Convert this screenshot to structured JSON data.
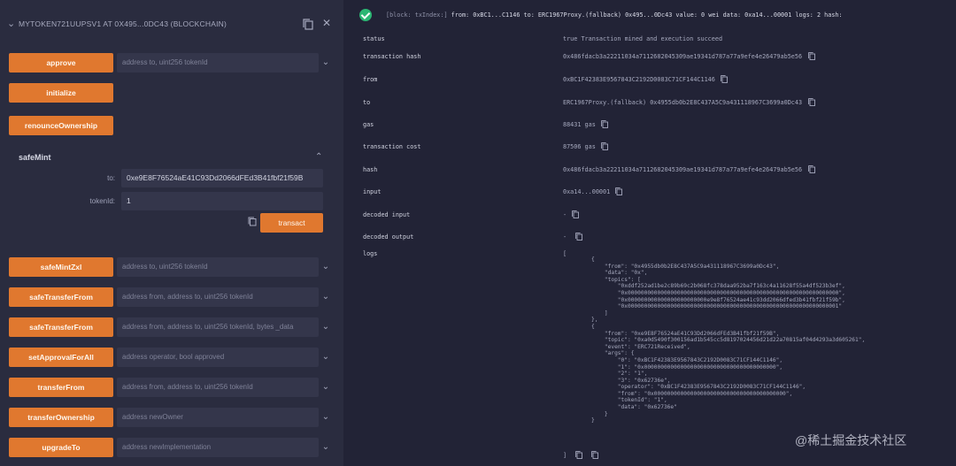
{
  "left": {
    "title": "MYTOKEN721UUPSV1 AT 0X495...0DC43 (BLOCKCHAIN)",
    "functions_top": [
      {
        "label": "approve",
        "placeholder": "address to, uint256 tokenId",
        "has_chevron": true
      },
      {
        "label": "initialize",
        "placeholder": "",
        "has_chevron": false
      },
      {
        "label": "renounceOwnership",
        "placeholder": "",
        "has_chevron": false
      }
    ],
    "safe_mint": {
      "title": "safeMint",
      "to_label": "to:",
      "to_value": "0xe9E8F76524aE41C93Dd2066dFEd3B41fbf21f59B",
      "token_label": "tokenId:",
      "token_value": "1",
      "transact_label": "transact"
    },
    "functions_bottom": [
      {
        "label": "safeMintZxl",
        "placeholder": "address to, uint256 tokenId"
      },
      {
        "label": "safeTransferFrom",
        "placeholder": "address from, address to, uint256 tokenId"
      },
      {
        "label": "safeTransferFrom",
        "placeholder": "address from, address to, uint256 tokenId, bytes _data"
      },
      {
        "label": "setApprovalForAll",
        "placeholder": "address operator, bool approved"
      },
      {
        "label": "transferFrom",
        "placeholder": "address from, address to, uint256 tokenId"
      },
      {
        "label": "transferOwnership",
        "placeholder": "address newOwner"
      },
      {
        "label": "upgradeTo",
        "placeholder": "address newImplementation"
      }
    ]
  },
  "right": {
    "summary_prefix": "[block: txIndex:]",
    "summary_rest": "from: 0xBC1...C1146 to: ERC1967Proxy.(fallback) 0x495...0Dc43 value: 0 wei data: 0xa14...00001 logs: 2 hash:",
    "rows": [
      {
        "key": "status",
        "value": "true Transaction mined and execution succeed",
        "copy": false
      },
      {
        "key": "transaction hash",
        "value": "0x486fdacb3a22211034a7112682045309ae19341d787a77a9efe4e26479ab5e56",
        "copy": true
      },
      {
        "key": "from",
        "value": "0xBC1F42383E9567843C2192D0083C71CF144C1146",
        "copy": true
      },
      {
        "key": "to",
        "value": "ERC1967Proxy.(fallback) 0x4955db0b2E8C437A5C9a431118967C3699a0Dc43",
        "copy": true
      },
      {
        "key": "gas",
        "value": "88431 gas",
        "copy": true
      },
      {
        "key": "transaction cost",
        "value": "87506 gas",
        "copy": true
      },
      {
        "key": "hash",
        "value": "0x486fdacb3a22211034a7112682045309ae19341d787a77a9efe4e26479ab5e56",
        "copy": true
      },
      {
        "key": "input",
        "value": "0xa14...00001",
        "copy": true
      },
      {
        "key": "decoded input",
        "value": "-",
        "copy": true
      },
      {
        "key": "decoded output",
        "value": " -",
        "copy": true
      },
      {
        "key": "logs",
        "value": "[",
        "copy": false
      }
    ],
    "logs_lines": [
      "{",
      "    \"from\": \"0x4955db0b2E8C437A5C9a431118967C3699a0Dc43\",",
      "    \"data\": \"0x\",",
      "    \"topics\": [",
      "        \"0xddf252ad1be2c89b69c2b068fc378daa952ba7f163c4a11628f55a4df523b3ef\",",
      "        \"0x0000000000000000000000000000000000000000000000000000000000000000\",",
      "        \"0x000000000000000000000000e9e8f76524ae41c93dd2066dfed3b41fbf21f59b\",",
      "        \"0x0000000000000000000000000000000000000000000000000000000000000001\"",
      "    ]",
      "},",
      "{",
      "    \"from\": \"0xe9E8F76524aE41C93Dd2066dFEd3B41fbf21f59B\",",
      "    \"topic\": \"0xa0d5490f300156ad1b545cc5d8197024456d21d22a70815af04d4293a3d605261\",",
      "    \"event\": \"ERC721Received\",",
      "    \"args\": {",
      "        \"0\": \"0xBC1F42383E9567843C2192D0083C71CF144C1146\",",
      "        \"1\": \"0x0000000000000000000000000000000000000000\",",
      "        \"2\": \"1\",",
      "        \"3\": \"0x62736e\",",
      "        \"operator\": \"0xBC1F42383E9567843C2192D0083C71CF144C1146\",",
      "        \"from\": \"0x0000000000000000000000000000000000000000\",",
      "        \"tokenId\": \"1\",",
      "        \"data\": \"0x62736e\"",
      "    }",
      "}"
    ],
    "logs_end": "]"
  },
  "watermark": "@稀土掘金技术社区",
  "colors": {
    "orange": "#e0782f",
    "success": "#2bb673",
    "panel": "#2a2c3f",
    "bg": "#222336"
  }
}
